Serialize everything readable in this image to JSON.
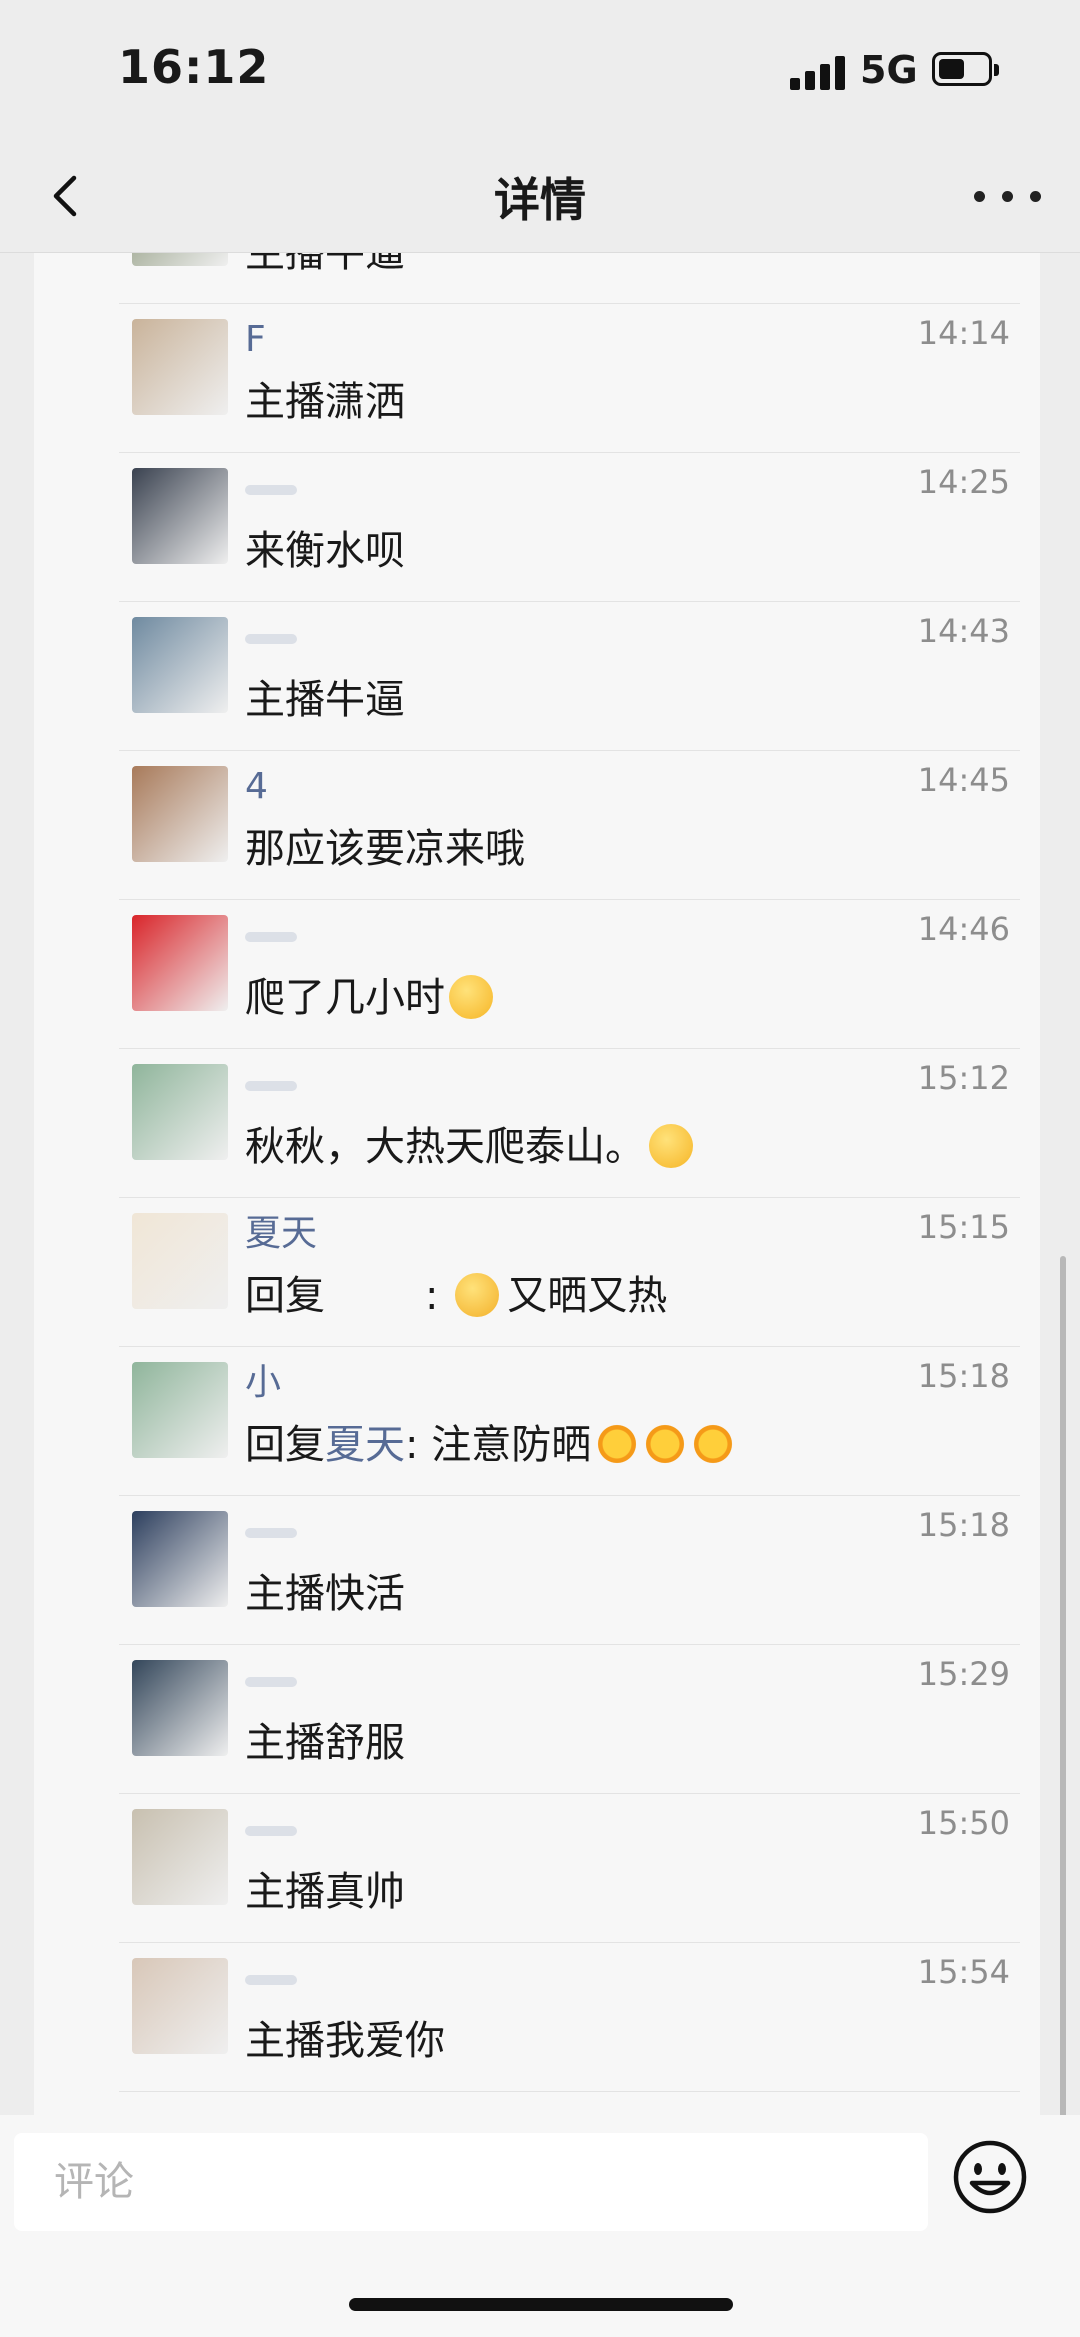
{
  "status_bar": {
    "time": "16:12",
    "network": "5G",
    "battery_level": 0.55
  },
  "nav": {
    "title": "详情",
    "back_icon": "chevron-left-icon",
    "more_icon": "more-dots-icon"
  },
  "comments": [
    {
      "name": "",
      "time": "",
      "text": "主播牛逼",
      "avatar_color": "#7d8a6a"
    },
    {
      "name": "F",
      "time": "14:14",
      "text": "主播潇洒",
      "avatar_color": "#c9b39a"
    },
    {
      "name": "",
      "time": "14:25",
      "text": "来衡水呗",
      "avatar_color": "#3a4250"
    },
    {
      "name": "",
      "time": "14:43",
      "text": "主播牛逼",
      "avatar_color": "#6f8aa0"
    },
    {
      "name": "4",
      "time": "14:45",
      "text": "那应该要凉来哦",
      "avatar_color": "#a87a5a"
    },
    {
      "name": "",
      "time": "14:46",
      "text": "爬了几小时",
      "emojis": [
        "thinking-face-emoji"
      ],
      "avatar_color": "#d9252a"
    },
    {
      "name": "",
      "time": "15:12",
      "text": "秋秋，大热天爬泰山。",
      "emojis": [
        "astonished-face-emoji"
      ],
      "avatar_color": "#8fb59b"
    },
    {
      "name": "夏天",
      "time": "15:15",
      "reply_prefix": "回复",
      "reply_to": "",
      "text": "又晒又热",
      "emojis_before": [
        "sad-face-emoji"
      ],
      "avatar_color": "#f0e6d6"
    },
    {
      "name": "小",
      "time": "15:18",
      "reply_prefix": "回复",
      "reply_to": "夏天",
      "text": "注意防晒",
      "emojis": [
        "sun-emoji",
        "sun-emoji",
        "sun-emoji"
      ],
      "avatar_color": "#8fb59b"
    },
    {
      "name": "",
      "time": "15:18",
      "text": "主播快活",
      "avatar_color": "#2d3f5e"
    },
    {
      "name": "",
      "time": "15:29",
      "text": "主播舒服",
      "avatar_color": "#33465a"
    },
    {
      "name": "",
      "time": "15:50",
      "text": "主播真帅",
      "avatar_color": "#c8c0b0"
    },
    {
      "name": "",
      "time": "15:54",
      "text": "主播我爱你",
      "avatar_color": "#d8c7b8"
    }
  ],
  "input": {
    "placeholder": "评论",
    "emoji_icon": "smiley-face-icon"
  },
  "colors": {
    "link": "#576b95",
    "background": "#ededed",
    "card": "#f7f7f7"
  }
}
